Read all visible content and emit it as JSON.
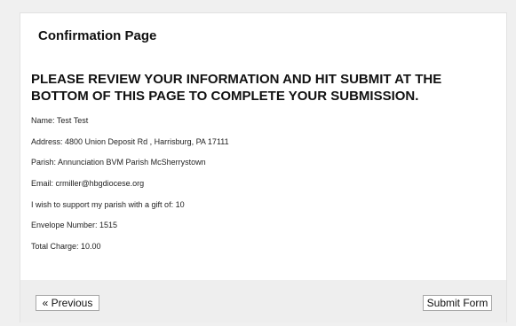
{
  "page": {
    "title": "Confirmation Page",
    "instruction": "PLEASE REVIEW YOUR INFORMATION AND HIT SUBMIT AT THE BOTTOM OF THIS PAGE TO COMPLETE YOUR SUBMISSION."
  },
  "fields": {
    "name": "Name: Test Test",
    "address": "Address: 4800 Union Deposit Rd , Harrisburg, PA 17111",
    "parish": "Parish: Annunciation BVM Parish McSherrystown",
    "email": "Email: crmiller@hbgdiocese.org",
    "gift": "I wish to support my parish with a gift of: 10",
    "envelope": "Envelope Number: 1515",
    "total": "Total Charge: 10.00"
  },
  "footer": {
    "previous_label": "« Previous",
    "submit_label": "Submit Form"
  }
}
